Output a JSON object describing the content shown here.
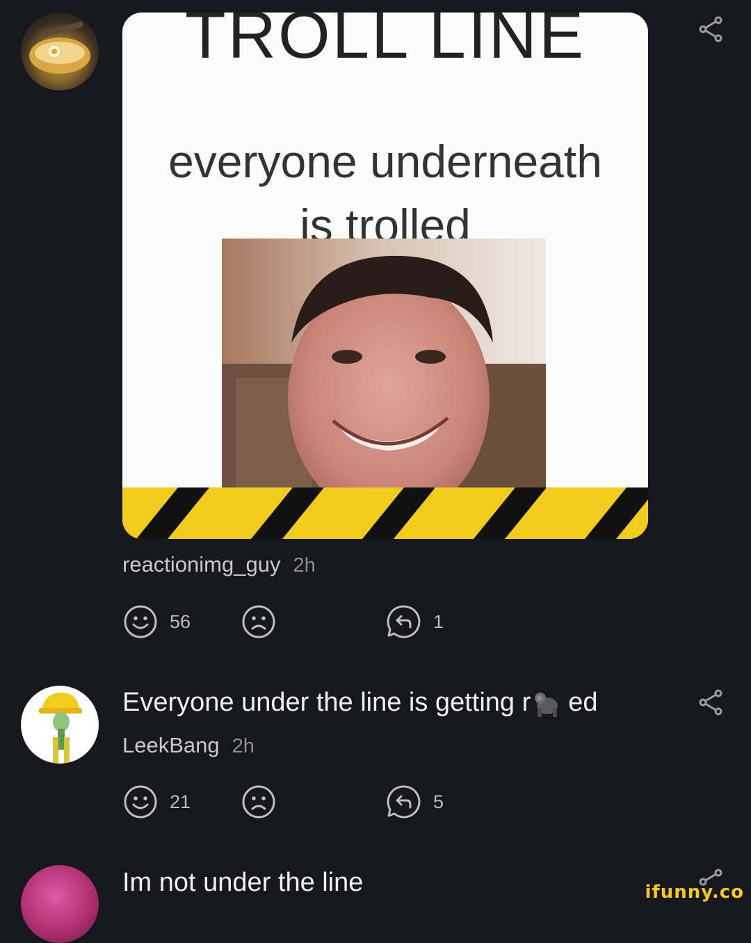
{
  "post": {
    "image_title": "TROLL LINE",
    "image_line1": "everyone underneath",
    "image_line2": "is trolled",
    "author": "reactionimg_guy",
    "time": "2h",
    "smile_count": "56",
    "reply_count": "1"
  },
  "comments": [
    {
      "text_before": "Everyone under the line is getting r",
      "text_after": "ed",
      "emoji": "gorilla",
      "author": "LeekBang",
      "time": "2h",
      "smile_count": "21",
      "reply_count": "5"
    },
    {
      "text": "Im not under the line"
    }
  ],
  "watermark": "ifunny.co",
  "colors": {
    "background": "#17181d",
    "text": "#f0f0f2",
    "muted": "#8c8c92",
    "hazard_yellow": "#f2cc1c",
    "hazard_black": "#111111",
    "watermark": "#f6c917"
  },
  "icons": [
    "share-icon",
    "smile-icon",
    "frown-icon",
    "reply-icon",
    "gorilla-icon"
  ]
}
